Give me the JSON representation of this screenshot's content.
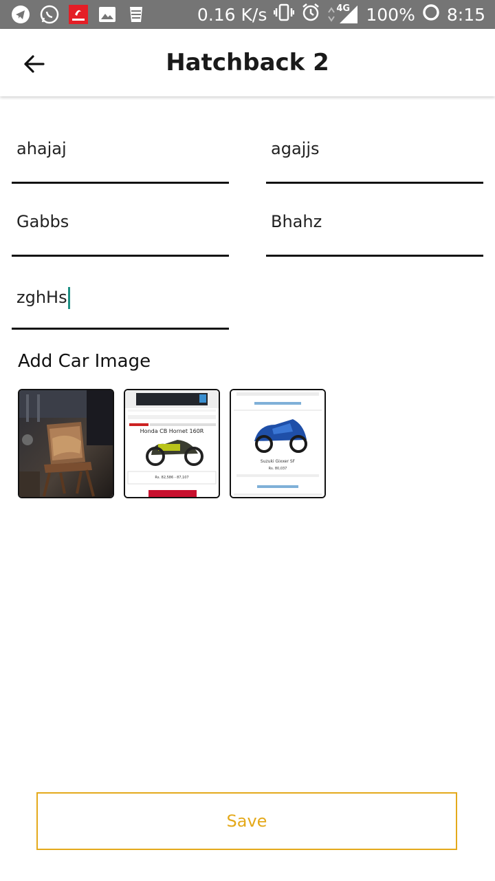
{
  "status_bar": {
    "speed": "0.16 K/s",
    "network": "4G",
    "battery": "100%",
    "time": "8:15",
    "left_icons": [
      "telegram-icon",
      "whatsapp-icon",
      "airtel-icon",
      "gallery-icon",
      "storage-icon"
    ],
    "right_icons": [
      "vibrate-icon",
      "alarm-icon",
      "signal-icon",
      "battery-ring-icon"
    ]
  },
  "header": {
    "title": "Hatchback 2",
    "back_icon": "arrow-left-icon"
  },
  "form": {
    "fields": [
      "ahajaj",
      "agajjs",
      "Gabbs",
      "Bhahz",
      "zghHs"
    ]
  },
  "images": {
    "section_label": "Add Car Image",
    "thumb2": {
      "title": "Honda CB Hornet 160R",
      "price": "Rs. 82,586 - 87,107"
    },
    "thumb3": {
      "title": "Suzuki Gixxer SF",
      "price": "Rs. 80,037"
    }
  },
  "actions": {
    "save_label": "Save"
  },
  "colors": {
    "status_bar_bg": "#757575",
    "accent": "#e4a91b",
    "caret": "#1d8f83"
  }
}
